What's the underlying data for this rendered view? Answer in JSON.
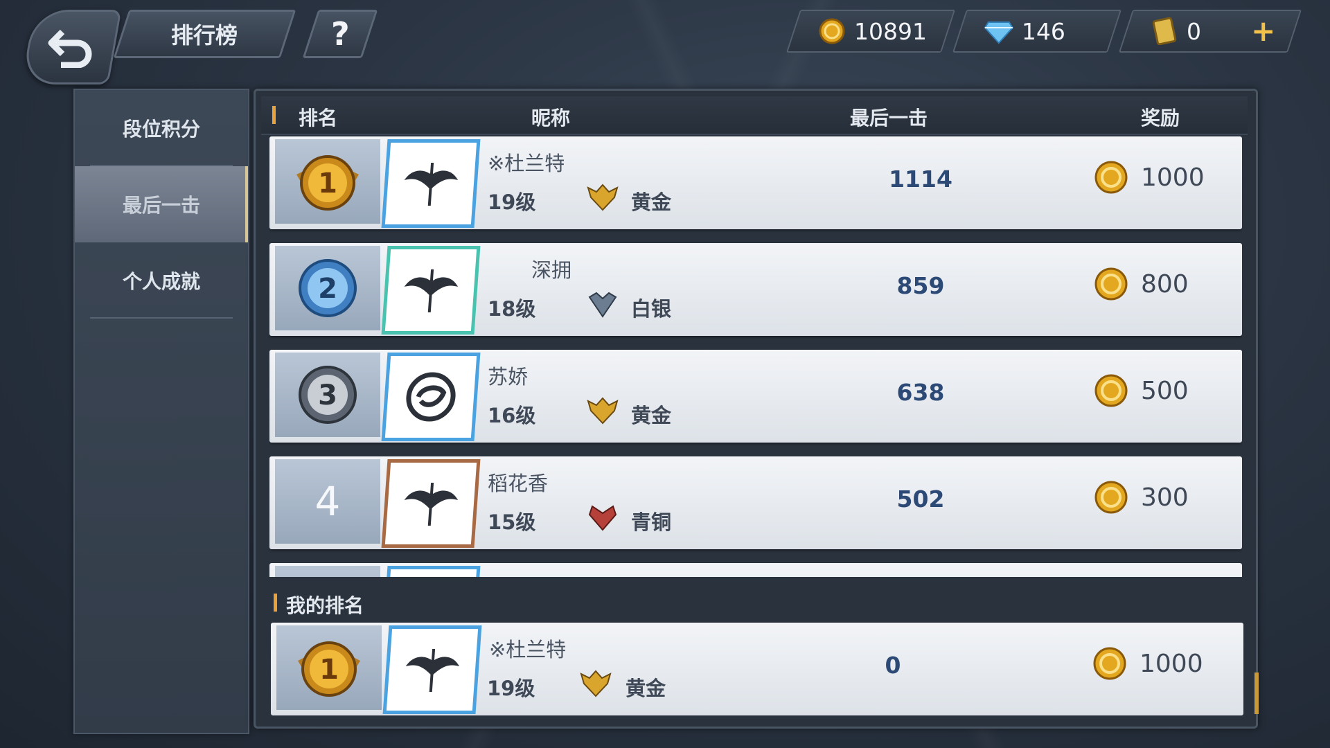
{
  "topbar": {
    "title": "排行榜",
    "help_label": "?",
    "gold": "10891",
    "diamonds": "146",
    "tickets": "0",
    "plus_label": "+"
  },
  "sidebar": {
    "items": [
      {
        "label": "段位积分"
      },
      {
        "label": "最后一击"
      },
      {
        "label": "个人成就"
      }
    ]
  },
  "table": {
    "headers": {
      "rank": "排名",
      "name": "昵称",
      "last_hit": "最后一击",
      "reward": "奖励"
    },
    "rows": [
      {
        "rank": "1",
        "name": "※杜兰特",
        "level": "19级",
        "tier": "黄金",
        "last_hit": "1114",
        "reward": "1000"
      },
      {
        "rank": "2",
        "name": "深拥",
        "level": "18级",
        "tier": "白银",
        "last_hit": "859",
        "reward": "800"
      },
      {
        "rank": "3",
        "name": "苏娇",
        "level": "16级",
        "tier": "黄金",
        "last_hit": "638",
        "reward": "500"
      },
      {
        "rank": "4",
        "name": "稻花香",
        "level": "15级",
        "tier": "青铜",
        "last_hit": "502",
        "reward": "300"
      }
    ]
  },
  "my_rank": {
    "title": "我的排名",
    "rank": "1",
    "name": "※杜兰特",
    "level": "19级",
    "tier": "黄金",
    "last_hit": "0",
    "reward": "1000"
  },
  "colors": {
    "accent": "#e8a23b",
    "gold_tier": "#d9a52c",
    "silver_tier": "#6c7d92",
    "bronze_tier": "#b5413a",
    "value_blue": "#2c4a75"
  }
}
